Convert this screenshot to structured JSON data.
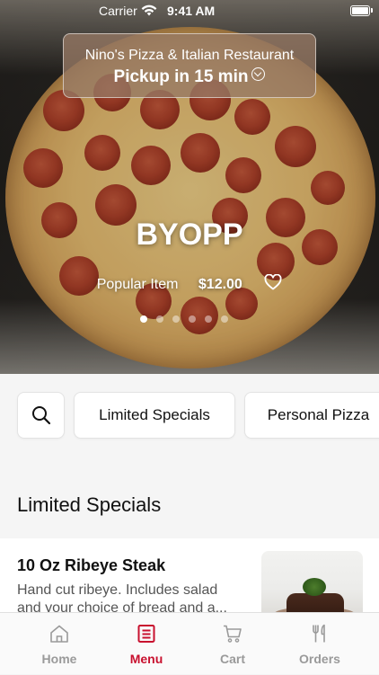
{
  "status_bar": {
    "carrier": "Carrier",
    "time": "9:41 AM"
  },
  "pickup": {
    "restaurant": "Nino's Pizza & Italian Restaurant",
    "time_label": "Pickup in 15 min"
  },
  "featured": {
    "name": "BYOPP",
    "tag": "Popular Item",
    "price": "$12.00",
    "carousel_pages": 6,
    "carousel_active": 1
  },
  "categories": [
    "Limited Specials",
    "Personal Pizza"
  ],
  "section": {
    "title": "Limited Specials"
  },
  "menu_item": {
    "name": "10 Oz Ribeye Steak",
    "description": "Hand cut ribeye. Includes salad and your choice of bread and a..."
  },
  "tabs": [
    {
      "label": "Home",
      "icon": "home-icon"
    },
    {
      "label": "Menu",
      "icon": "menu-icon",
      "active": true
    },
    {
      "label": "Cart",
      "icon": "cart-icon"
    },
    {
      "label": "Orders",
      "icon": "fork-knife-icon"
    }
  ],
  "colors": {
    "accent": "#c8102e",
    "tab_inactive": "#9a9a9a"
  }
}
